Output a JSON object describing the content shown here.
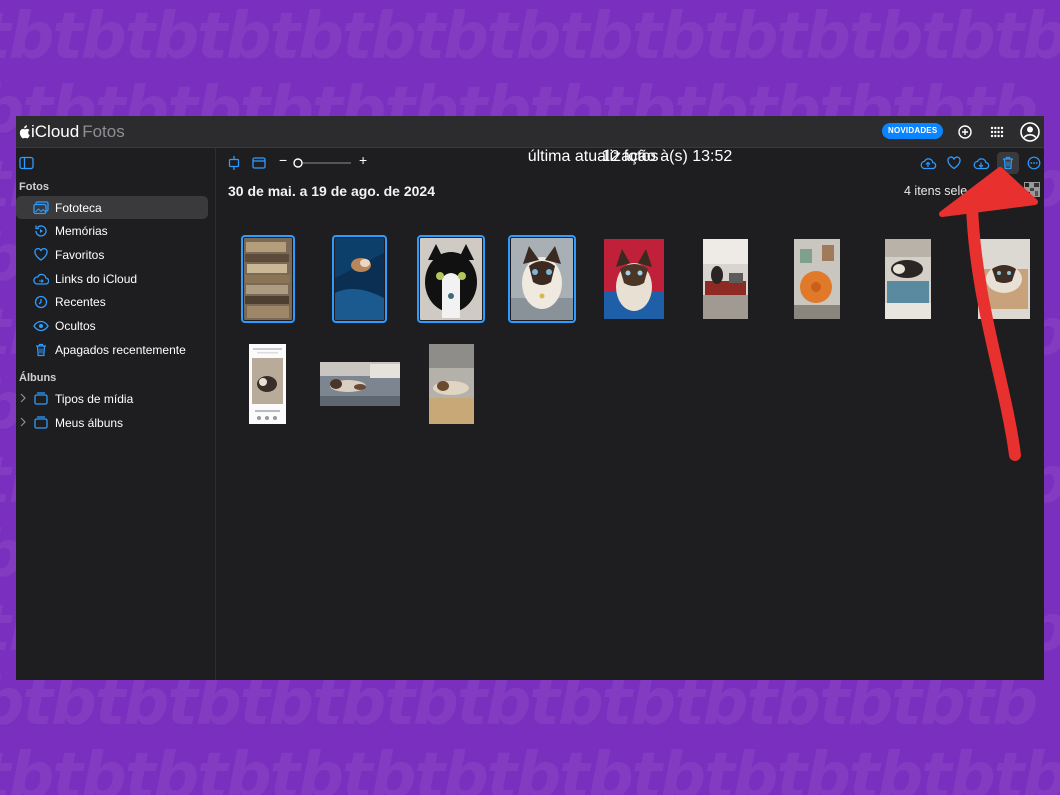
{
  "app": {
    "name": "iCloud",
    "section": "Fotos"
  },
  "topbar": {
    "news_badge": "NOVIDADES"
  },
  "sidebar": {
    "section_fotos": "Fotos",
    "items": [
      {
        "label": "Fototeca",
        "icon": "photo-library-icon",
        "selected": true
      },
      {
        "label": "Memórias",
        "icon": "memories-icon"
      },
      {
        "label": "Favoritos",
        "icon": "heart-icon"
      },
      {
        "label": "Links do iCloud",
        "icon": "icloud-link-icon"
      },
      {
        "label": "Recentes",
        "icon": "clock-icon"
      },
      {
        "label": "Ocultos",
        "icon": "eye-icon"
      },
      {
        "label": "Apagados recentemente",
        "icon": "trash-icon"
      }
    ],
    "section_albuns": "Álbuns",
    "albums": [
      {
        "label": "Tipos de mídia",
        "icon": "folder-icon"
      },
      {
        "label": "Meus álbuns",
        "icon": "folder-icon"
      }
    ]
  },
  "main": {
    "date_range": "30 de mai. a 19 de ago. de 2024",
    "selection_count": "4 itens sele",
    "zoom_minus": "−",
    "zoom_plus": "+",
    "photos": [
      {
        "selected": true
      },
      {
        "selected": true
      },
      {
        "selected": true
      },
      {
        "selected": true
      },
      {
        "selected": false
      },
      {
        "selected": false
      },
      {
        "selected": false
      },
      {
        "selected": false
      },
      {
        "selected": false
      },
      {
        "selected": false
      },
      {
        "selected": false
      },
      {
        "selected": false
      }
    ],
    "footer": {
      "count": "12 fotos",
      "updated": "última atualização à(s) 13:52"
    }
  },
  "colors": {
    "accent": "#2e9bff",
    "background": "#7b2fbe",
    "annotation_arrow": "#e8302f"
  }
}
